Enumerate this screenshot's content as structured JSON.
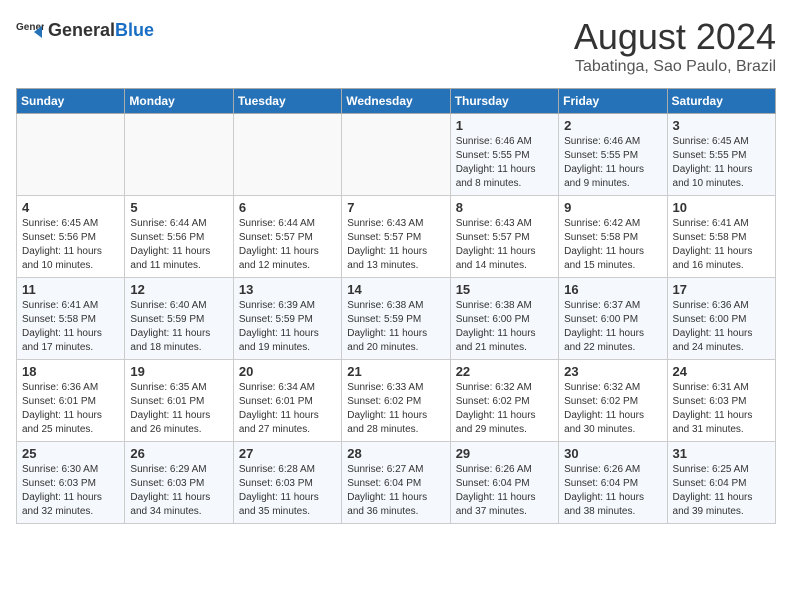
{
  "header": {
    "logo_general": "General",
    "logo_blue": "Blue",
    "month_year": "August 2024",
    "location": "Tabatinga, Sao Paulo, Brazil"
  },
  "days_of_week": [
    "Sunday",
    "Monday",
    "Tuesday",
    "Wednesday",
    "Thursday",
    "Friday",
    "Saturday"
  ],
  "weeks": [
    [
      {
        "day": "",
        "text": ""
      },
      {
        "day": "",
        "text": ""
      },
      {
        "day": "",
        "text": ""
      },
      {
        "day": "",
        "text": ""
      },
      {
        "day": "1",
        "text": "Sunrise: 6:46 AM\nSunset: 5:55 PM\nDaylight: 11 hours and 8 minutes."
      },
      {
        "day": "2",
        "text": "Sunrise: 6:46 AM\nSunset: 5:55 PM\nDaylight: 11 hours and 9 minutes."
      },
      {
        "day": "3",
        "text": "Sunrise: 6:45 AM\nSunset: 5:55 PM\nDaylight: 11 hours and 10 minutes."
      }
    ],
    [
      {
        "day": "4",
        "text": "Sunrise: 6:45 AM\nSunset: 5:56 PM\nDaylight: 11 hours and 10 minutes."
      },
      {
        "day": "5",
        "text": "Sunrise: 6:44 AM\nSunset: 5:56 PM\nDaylight: 11 hours and 11 minutes."
      },
      {
        "day": "6",
        "text": "Sunrise: 6:44 AM\nSunset: 5:57 PM\nDaylight: 11 hours and 12 minutes."
      },
      {
        "day": "7",
        "text": "Sunrise: 6:43 AM\nSunset: 5:57 PM\nDaylight: 11 hours and 13 minutes."
      },
      {
        "day": "8",
        "text": "Sunrise: 6:43 AM\nSunset: 5:57 PM\nDaylight: 11 hours and 14 minutes."
      },
      {
        "day": "9",
        "text": "Sunrise: 6:42 AM\nSunset: 5:58 PM\nDaylight: 11 hours and 15 minutes."
      },
      {
        "day": "10",
        "text": "Sunrise: 6:41 AM\nSunset: 5:58 PM\nDaylight: 11 hours and 16 minutes."
      }
    ],
    [
      {
        "day": "11",
        "text": "Sunrise: 6:41 AM\nSunset: 5:58 PM\nDaylight: 11 hours and 17 minutes."
      },
      {
        "day": "12",
        "text": "Sunrise: 6:40 AM\nSunset: 5:59 PM\nDaylight: 11 hours and 18 minutes."
      },
      {
        "day": "13",
        "text": "Sunrise: 6:39 AM\nSunset: 5:59 PM\nDaylight: 11 hours and 19 minutes."
      },
      {
        "day": "14",
        "text": "Sunrise: 6:38 AM\nSunset: 5:59 PM\nDaylight: 11 hours and 20 minutes."
      },
      {
        "day": "15",
        "text": "Sunrise: 6:38 AM\nSunset: 6:00 PM\nDaylight: 11 hours and 21 minutes."
      },
      {
        "day": "16",
        "text": "Sunrise: 6:37 AM\nSunset: 6:00 PM\nDaylight: 11 hours and 22 minutes."
      },
      {
        "day": "17",
        "text": "Sunrise: 6:36 AM\nSunset: 6:00 PM\nDaylight: 11 hours and 24 minutes."
      }
    ],
    [
      {
        "day": "18",
        "text": "Sunrise: 6:36 AM\nSunset: 6:01 PM\nDaylight: 11 hours and 25 minutes."
      },
      {
        "day": "19",
        "text": "Sunrise: 6:35 AM\nSunset: 6:01 PM\nDaylight: 11 hours and 26 minutes."
      },
      {
        "day": "20",
        "text": "Sunrise: 6:34 AM\nSunset: 6:01 PM\nDaylight: 11 hours and 27 minutes."
      },
      {
        "day": "21",
        "text": "Sunrise: 6:33 AM\nSunset: 6:02 PM\nDaylight: 11 hours and 28 minutes."
      },
      {
        "day": "22",
        "text": "Sunrise: 6:32 AM\nSunset: 6:02 PM\nDaylight: 11 hours and 29 minutes."
      },
      {
        "day": "23",
        "text": "Sunrise: 6:32 AM\nSunset: 6:02 PM\nDaylight: 11 hours and 30 minutes."
      },
      {
        "day": "24",
        "text": "Sunrise: 6:31 AM\nSunset: 6:03 PM\nDaylight: 11 hours and 31 minutes."
      }
    ],
    [
      {
        "day": "25",
        "text": "Sunrise: 6:30 AM\nSunset: 6:03 PM\nDaylight: 11 hours and 32 minutes."
      },
      {
        "day": "26",
        "text": "Sunrise: 6:29 AM\nSunset: 6:03 PM\nDaylight: 11 hours and 34 minutes."
      },
      {
        "day": "27",
        "text": "Sunrise: 6:28 AM\nSunset: 6:03 PM\nDaylight: 11 hours and 35 minutes."
      },
      {
        "day": "28",
        "text": "Sunrise: 6:27 AM\nSunset: 6:04 PM\nDaylight: 11 hours and 36 minutes."
      },
      {
        "day": "29",
        "text": "Sunrise: 6:26 AM\nSunset: 6:04 PM\nDaylight: 11 hours and 37 minutes."
      },
      {
        "day": "30",
        "text": "Sunrise: 6:26 AM\nSunset: 6:04 PM\nDaylight: 11 hours and 38 minutes."
      },
      {
        "day": "31",
        "text": "Sunrise: 6:25 AM\nSunset: 6:04 PM\nDaylight: 11 hours and 39 minutes."
      }
    ]
  ]
}
